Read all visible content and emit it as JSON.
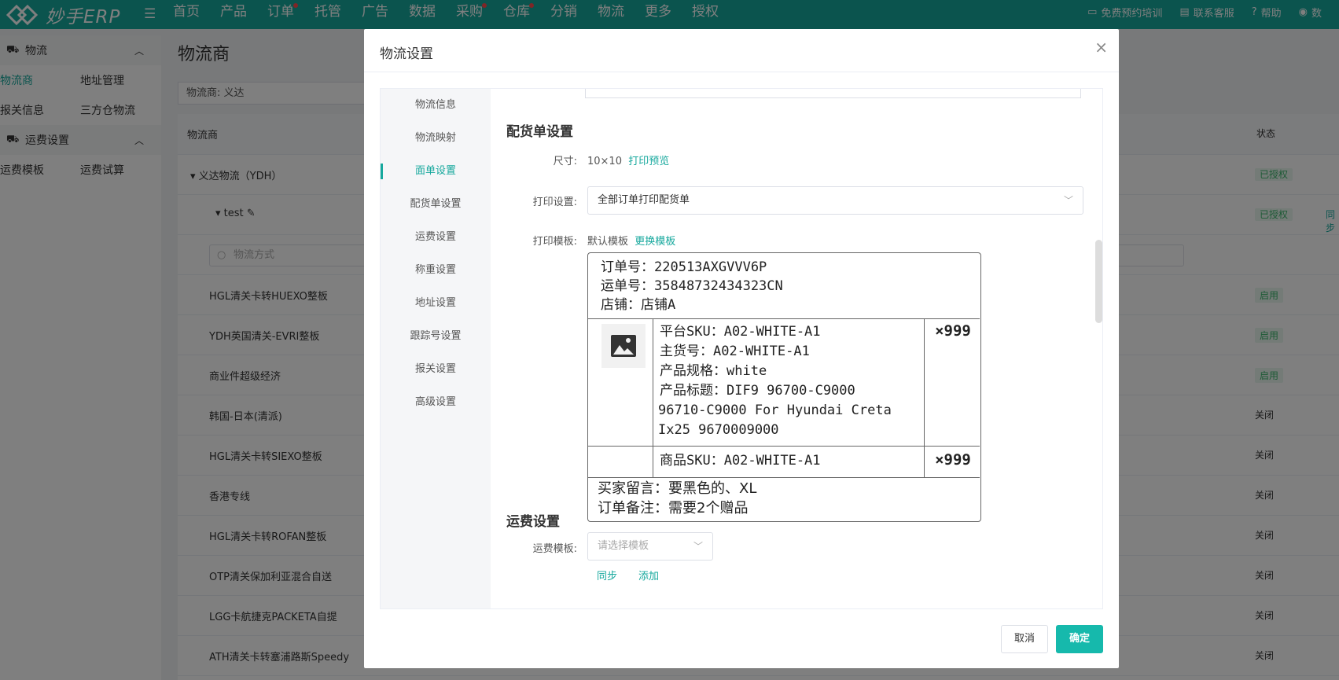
{
  "app": {
    "logo_text": "妙手ERP",
    "accent": "#16a89d"
  },
  "nav": {
    "items": [
      "首页",
      "产品",
      "订单",
      "托管",
      "广告",
      "数据",
      "采购",
      "仓库",
      "分销",
      "物流",
      "更多",
      "授权"
    ]
  },
  "topright": {
    "items": [
      {
        "icon": "monitor-icon",
        "label": "免费预约培训"
      },
      {
        "icon": "chat-icon",
        "label": "联系客服"
      },
      {
        "icon": "help-icon",
        "label": "帮助"
      },
      {
        "icon": "data-icon",
        "label": "数"
      }
    ]
  },
  "sidebar": {
    "group1": "物流",
    "group1_items": [
      [
        "物流商",
        "地址管理"
      ],
      [
        "报关信息",
        "三方仓物流"
      ]
    ],
    "group2": "运费设置",
    "group2_items": [
      [
        "运费模板",
        "运费试算"
      ]
    ]
  },
  "page": {
    "title": "物流商",
    "filter_text": "物流商:  义达",
    "col_name": "物流商",
    "col_status": "状态",
    "row_main": "义达物流（YDH）",
    "row_main_status": "已授权",
    "row_sub": "test",
    "row_sub_status": "已授权",
    "row_sub_action": "同步",
    "search_placeholder": "物流方式",
    "rows": [
      {
        "name": "HGL清关卡转HUEXO整板",
        "status": "启用"
      },
      {
        "name": "YDH英国清关-EVRI整板",
        "status": "启用"
      },
      {
        "name": "商业件超级经济",
        "status": "启用"
      },
      {
        "name": "韩国-日本(清派)",
        "status": "关闭"
      },
      {
        "name": "HGL清关卡转SIEXO整板",
        "status": "关闭"
      },
      {
        "name": "香港专线",
        "status": "关闭"
      },
      {
        "name": "HGL清关卡转ROFAN整板",
        "status": "关闭"
      },
      {
        "name": "OTP清关保加利亚混合自送",
        "status": "关闭"
      },
      {
        "name": "LGG卡航捷克PACKETA自提",
        "status": "关闭"
      },
      {
        "name": "ATH清关卡转塞浦路斯Speedy",
        "status": "关闭"
      }
    ]
  },
  "modal": {
    "title": "物流设置",
    "tabs": [
      "物流信息",
      "物流映射",
      "面单设置",
      "配货单设置",
      "运费设置",
      "称重设置",
      "地址设置",
      "跟踪号设置",
      "报关设置",
      "高级设置"
    ],
    "active_tab_index": 2,
    "packing": {
      "section_title": "配货单设置",
      "size_label": "尺寸:",
      "size_value": "10×10",
      "preview_link": "打印预览",
      "print_setting_label": "打印设置:",
      "print_setting_value": "全部订单打印配货单",
      "template_label": "打印模板:",
      "template_value": "默认模板",
      "template_link": "更换模板"
    },
    "preview": {
      "order_no": "订单号：220513AXGVVV6P",
      "waybill_no": "运单号：35848732434323CN",
      "shop": "店铺：店铺A",
      "platform_sku": "平台SKU：A02-WHITE-A1",
      "main_no": "主货号：A02-WHITE-A1",
      "spec": "产品规格：white",
      "title_line1": "产品标题：DIF9 96700-C9000",
      "title_line2": "96710-C9000 For Hyundai Creta",
      "title_line3": "Ix25 9670009000",
      "qty1": "×999",
      "item_sku": "商品SKU：A02-WHITE-A1",
      "qty2": "×999",
      "buyer_msg": "买家留言：要黑色的、XL",
      "order_note": "订单备注：需要2个赠品"
    },
    "freight": {
      "section_title": "运费设置",
      "template_label": "运费模板:",
      "template_placeholder": "请选择模板",
      "link1": "同步",
      "link2": "添加"
    },
    "cancel": "取消",
    "ok": "确定"
  }
}
